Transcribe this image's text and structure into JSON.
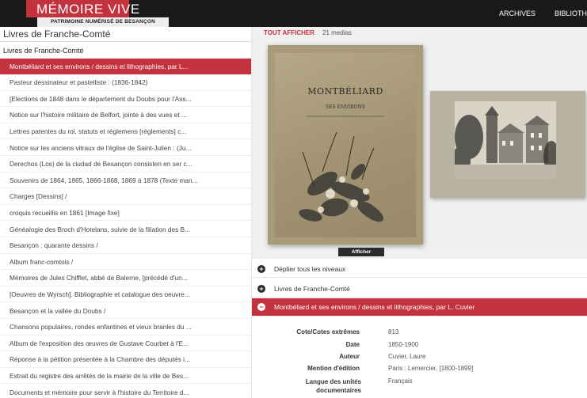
{
  "header": {
    "logo_title": "MÉMOIRE VIVE",
    "logo_subtitle": "PATRIMOINE NUMÉRISÉ DE BESANÇON",
    "nav": [
      "ARCHIVES",
      "BIBLIOTHÈ"
    ]
  },
  "sidebar": {
    "title": "Livres de Franche-Comté",
    "section": "Livres de Franche-Comté",
    "items": [
      "Montbéliard et ses environs / dessins et lithographies, par L...",
      "Pasteur dessinateur et pastelliste : (1836-1842)",
      "[Elections de 1848 dans le département du Doubs pour l'Ass...",
      "Notice sur l'histoire militaire de Belfort, jointe à des vues et ...",
      "Lettres patentes du roi, statuts et réglemens [réglements] c...",
      "Notice sur les anciens vitraux de l'église de Saint-Julien : (Ju...",
      "Derechos (Los) de la ciudad de Besançon consisten en ser c...",
      "Souvenirs de 1864, 1865, 1866-1868, 1869 à 1878 (Texte man...",
      "Charges [Dessins] /",
      "croquis recueillis en 1861 [Image fixe]",
      "Généalogie des Broch d'Hotelans, suivie de la filiation des B...",
      "Besançon : quarante dessins /",
      "Album franc-comtois /",
      "Mémoires de Jules Chifflet, abbé de Balerne, [précédé d'un...",
      "[Oeuvres de Wyrsch]. Bibliographie et catalogue des oeuvre...",
      "Besançon et la vallée du Doubs /",
      "Chansons populaires, rondes enfantines et vieux branles du ...",
      "Album de l'exposition des œuvres de Gustave Courbet à l'E...",
      "Réponse à la pétition présentée à la Chambre des députés i...",
      "Extrait du registre des arrêtés de la mairie de la ville de Bes...",
      "Documents et mémoire pour servir à l'histoire du Territoire d..."
    ]
  },
  "gallery": {
    "show_all": "TOUT AFFICHER",
    "media_count": "21 medias",
    "cover_title": "MONTBÉLIARD",
    "cover_subtitle": "SES ENVIRONS",
    "open_button": "Afficher"
  },
  "tree": {
    "expand_all": "Déplier tous les niveaux",
    "parent": "Livres de Franche-Comté",
    "current": "Montbéliard et ses environs / dessins et lithographies, par L. Cuvier"
  },
  "metadata": [
    {
      "label": "Cote/Cotes extrêmes",
      "value": "813"
    },
    {
      "label": "Date",
      "value": "1850-1900"
    },
    {
      "label": "Auteur",
      "value": "Cuvier, Laure"
    },
    {
      "label": "Mention d'édition",
      "value": "Paris : Lemercier, [1800-1899]"
    },
    {
      "label": "Langue des unités documentaires",
      "value": "Français"
    }
  ],
  "colors": {
    "accent": "#c4333d",
    "topbar": "#1a1a1a"
  }
}
